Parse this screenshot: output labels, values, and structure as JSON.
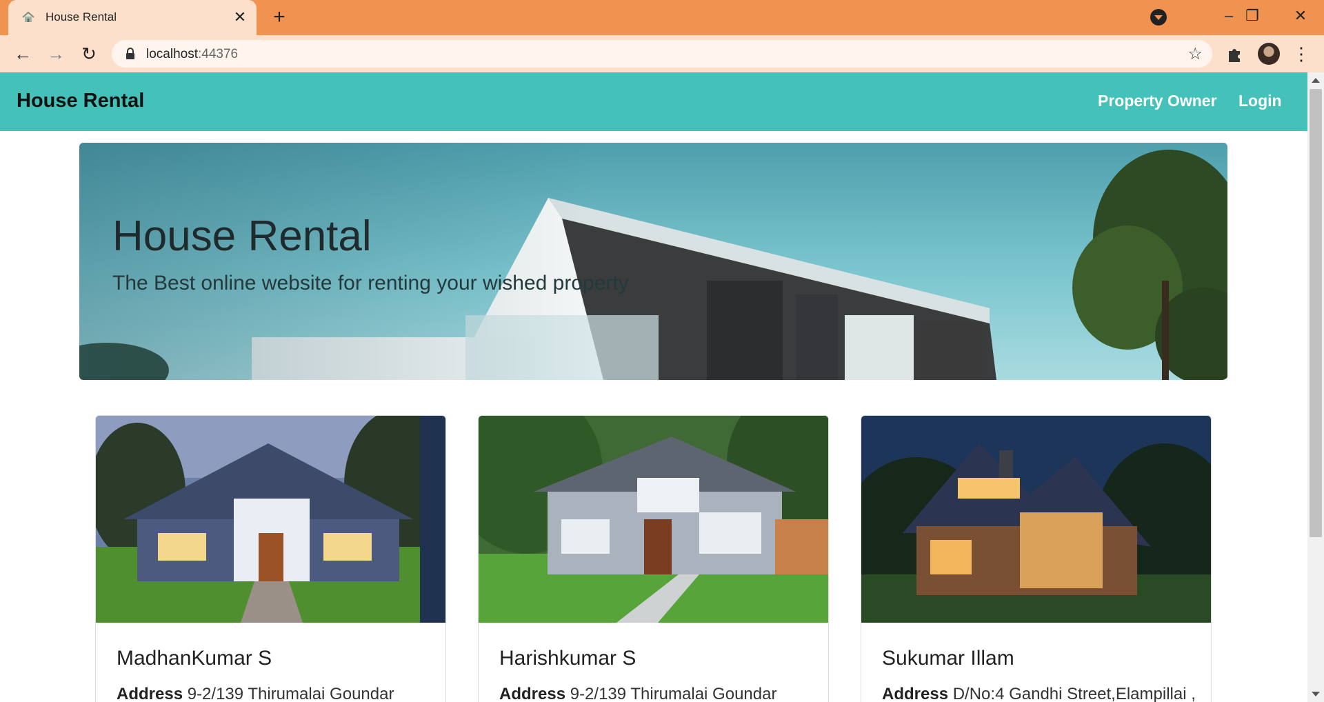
{
  "browser": {
    "tab_title": "House Rental",
    "url_host": "localhost",
    "url_port": ":44376"
  },
  "navbar": {
    "brand": "House Rental",
    "links": [
      "Property Owner",
      "Login"
    ]
  },
  "hero": {
    "title": "House Rental",
    "subtitle": "The Best online website for renting your wished property"
  },
  "cards": [
    {
      "name": "MadhanKumar S",
      "address_label": "Address",
      "address": "9-2/139 Thirumalai Goundar"
    },
    {
      "name": "Harishkumar S",
      "address_label": "Address",
      "address": "9-2/139 Thirumalai Goundar"
    },
    {
      "name": "Sukumar Illam",
      "address_label": "Address",
      "address": "D/No:4 Gandhi Street,Elampillai ,"
    }
  ],
  "icons": {
    "tab_close": "close-icon",
    "new_tab": "plus-icon",
    "back": "arrow-left-icon",
    "forward": "arrow-right-icon",
    "reload": "reload-icon",
    "bookmark": "star-icon",
    "extensions": "puzzle-icon",
    "menu": "kebab-menu-icon"
  },
  "colors": {
    "chrome_accent": "#f09250",
    "navbar": "#44c1b8"
  }
}
